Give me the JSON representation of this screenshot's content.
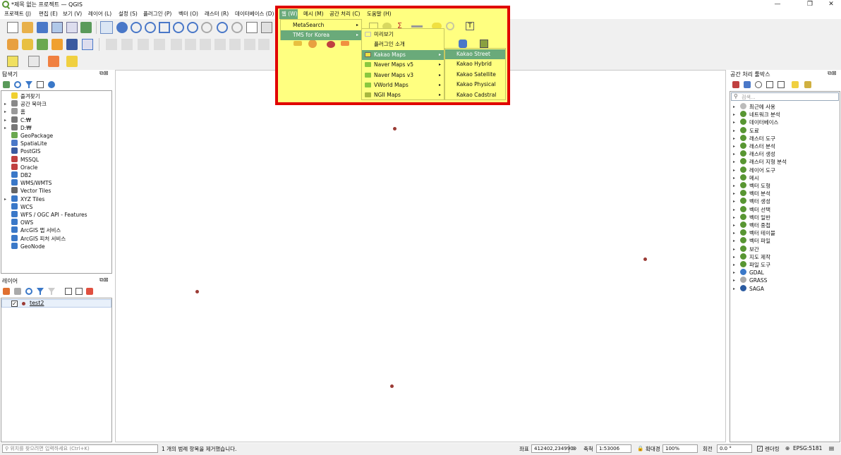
{
  "window": {
    "title": "*제목 없는 프로젝트 — QGIS",
    "controls": {
      "minimize": "—",
      "restore": "❐",
      "close": "✕"
    }
  },
  "menubar": {
    "items": [
      "프로젝트 (J)",
      "편집 (E)",
      "보기 (V)",
      "레이어 (L)",
      "설정 (S)",
      "플러그인 (P)",
      "벡터 (O)",
      "래스터 (R)",
      "데이터베이스 (D)",
      "웹 (W)",
      "메시 (M)",
      "공간 처리 (C)",
      "도움말 (H)"
    ]
  },
  "web_menu": {
    "items": [
      {
        "label": "MetaSearch",
        "has_submenu": true,
        "selected": false
      },
      {
        "label": "TMS for Korea",
        "has_submenu": true,
        "selected": true
      }
    ]
  },
  "tms_submenu": {
    "items": [
      {
        "label": "미리보기",
        "has_submenu": false,
        "selected": false
      },
      {
        "label": "플러그인 소개",
        "has_submenu": false,
        "selected": false
      },
      {
        "label": "Kakao Maps",
        "has_submenu": true,
        "selected": true
      },
      {
        "label": "Naver Maps v5",
        "has_submenu": true,
        "selected": false
      },
      {
        "label": "Naver Maps v3",
        "has_submenu": true,
        "selected": false
      },
      {
        "label": "VWorld Maps",
        "has_submenu": true,
        "selected": false
      },
      {
        "label": "NGII Maps",
        "has_submenu": true,
        "selected": false
      }
    ]
  },
  "kakao_submenu": {
    "items": [
      {
        "label": "Kakao Street",
        "selected": true
      },
      {
        "label": "Kakao Hybrid",
        "selected": false
      },
      {
        "label": "Kakao Satellite",
        "selected": false
      },
      {
        "label": "Kakao Physical",
        "selected": false
      },
      {
        "label": "Kakao Cadstral",
        "selected": false
      }
    ]
  },
  "browser_panel": {
    "title": "탐색기",
    "items": [
      {
        "label": "즐겨찾기",
        "icon": "star-icon",
        "expandable": false
      },
      {
        "label": "공간 북마크",
        "icon": "bookmark-icon",
        "expandable": true
      },
      {
        "label": "홈",
        "icon": "home-folder-icon",
        "expandable": true
      },
      {
        "label": "C:₩",
        "icon": "drive-icon",
        "expandable": true
      },
      {
        "label": "D:₩",
        "icon": "drive-icon",
        "expandable": true
      },
      {
        "label": "GeoPackage",
        "icon": "geopackage-icon",
        "expandable": false
      },
      {
        "label": "SpatiaLite",
        "icon": "spatialite-icon",
        "expandable": false
      },
      {
        "label": "PostGIS",
        "icon": "postgis-icon",
        "expandable": false
      },
      {
        "label": "MSSQL",
        "icon": "mssql-icon",
        "expandable": false
      },
      {
        "label": "Oracle",
        "icon": "oracle-icon",
        "expandable": false
      },
      {
        "label": "DB2",
        "icon": "db2-icon",
        "expandable": false
      },
      {
        "label": "WMS/WMTS",
        "icon": "wms-icon",
        "expandable": false
      },
      {
        "label": "Vector Tiles",
        "icon": "vector-tiles-icon",
        "expandable": false
      },
      {
        "label": "XYZ Tiles",
        "icon": "xyz-tiles-icon",
        "expandable": true
      },
      {
        "label": "WCS",
        "icon": "wcs-icon",
        "expandable": false
      },
      {
        "label": "WFS / OGC API - Features",
        "icon": "wfs-icon",
        "expandable": false
      },
      {
        "label": "OWS",
        "icon": "ows-icon",
        "expandable": false
      },
      {
        "label": "ArcGIS 맵 서비스",
        "icon": "arcgis-map-icon",
        "expandable": false
      },
      {
        "label": "ArcGIS 피처 서비스",
        "icon": "arcgis-feature-icon",
        "expandable": false
      },
      {
        "label": "GeoNode",
        "icon": "geonode-icon",
        "expandable": false
      }
    ]
  },
  "layers_panel": {
    "title": "레이어",
    "layers": [
      {
        "name": "test2",
        "checked": true
      }
    ]
  },
  "processing_panel": {
    "title": "공간 처리 툴박스",
    "search_placeholder": "검색...",
    "items": [
      "최근에 사용",
      "네트워크 분석",
      "데이터베이스",
      "도료",
      "래스터 도구",
      "래스터 분석",
      "래스터 생성",
      "래스터 지형 분석",
      "레이어 도구",
      "메시",
      "벡터 도형",
      "벡터 분석",
      "벡터 생성",
      "벡터 선택",
      "벡터 일반",
      "벡터 중첩",
      "벡터 테이블",
      "벡터 파일",
      "보간",
      "지도 제작",
      "파일 도구",
      "GDAL",
      "GRASS",
      "SAGA"
    ]
  },
  "statusbar": {
    "locator_placeholder": "위치를 찾으려면 입력하세요 (Ctrl+K)",
    "message": "1 개의 범례 항목을 제거했습니다.",
    "coord_label": "좌표",
    "coord_value": "412402,234990",
    "scale_label": "축척",
    "scale_value": "1:53006",
    "magnifier_label": "확대경",
    "magnifier_value": "100%",
    "rotation_label": "회전",
    "rotation_value": "0.0 °",
    "render_label": "렌더링",
    "crs": "EPSG:5181"
  },
  "colors": {
    "qgis_green": "#589632",
    "menu_highlight": "#ffff80",
    "selected_item": "#6aaa7a",
    "annotation_box": "#e00000",
    "point_color": "#9b3b35"
  }
}
